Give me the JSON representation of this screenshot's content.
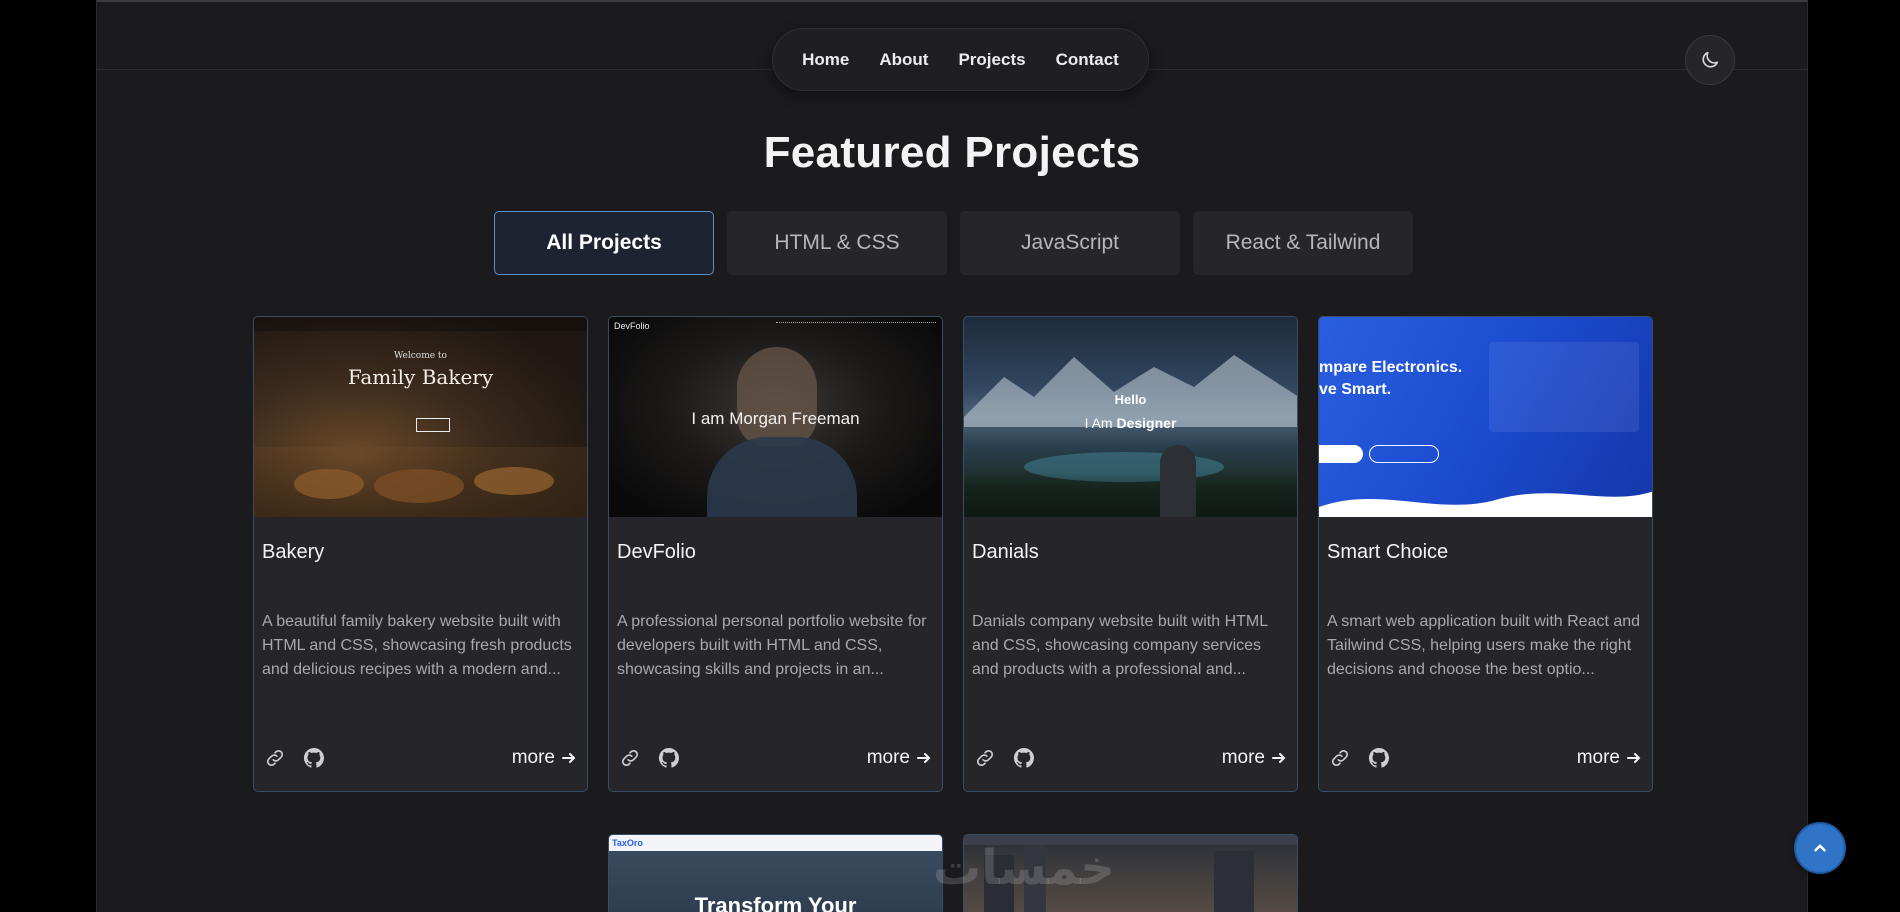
{
  "nav": {
    "items": [
      {
        "label": "Home"
      },
      {
        "label": "About"
      },
      {
        "label": "Projects"
      },
      {
        "label": "Contact"
      }
    ],
    "theme_icon": "moon-icon"
  },
  "page_title": "Featured Projects",
  "filters": [
    {
      "label": "All Projects",
      "active": true
    },
    {
      "label": "HTML & CSS",
      "active": false
    },
    {
      "label": "JavaScript",
      "active": false
    },
    {
      "label": "React & Tailwind",
      "active": false
    }
  ],
  "projects": [
    {
      "title": "Bakery",
      "description": "A beautiful family bakery website built with HTML and CSS, showcasing fresh products and delicious recipes with a modern and...",
      "more_label": "more",
      "thumb": {
        "heading": "Family Bakery",
        "subheading": "Welcome to"
      }
    },
    {
      "title": "DevFolio",
      "description": "A professional personal portfolio website for developers built with HTML and CSS, showcasing skills and projects in an...",
      "more_label": "more",
      "thumb": {
        "brand": "DevFolio",
        "heading": "I am Morgan Freeman"
      }
    },
    {
      "title": "Danials",
      "description": "Danials company website built with HTML and CSS, showcasing company services and products with a professional and...",
      "more_label": "more",
      "thumb": {
        "line1": "Hello",
        "line2_prefix": "I Am ",
        "line2_emph": "Designer"
      }
    },
    {
      "title": "Smart Choice",
      "description": "A smart web application built with React and Tailwind CSS, helping users make the right decisions and choose the best optio...",
      "more_label": "more",
      "thumb": {
        "line1": "mpare Electronics.",
        "line2": "ve Smart."
      }
    }
  ],
  "partial_projects": [
    {
      "thumb": {
        "brand": "TaxOro",
        "heading": "Transform Your"
      }
    },
    {
      "thumb": {}
    }
  ],
  "watermark": "خمسات",
  "colors": {
    "background": "#1b1b1e",
    "card": "#25252a",
    "accent_blue": "#2f74c7",
    "active_filter_border": "#5a8fc0"
  }
}
